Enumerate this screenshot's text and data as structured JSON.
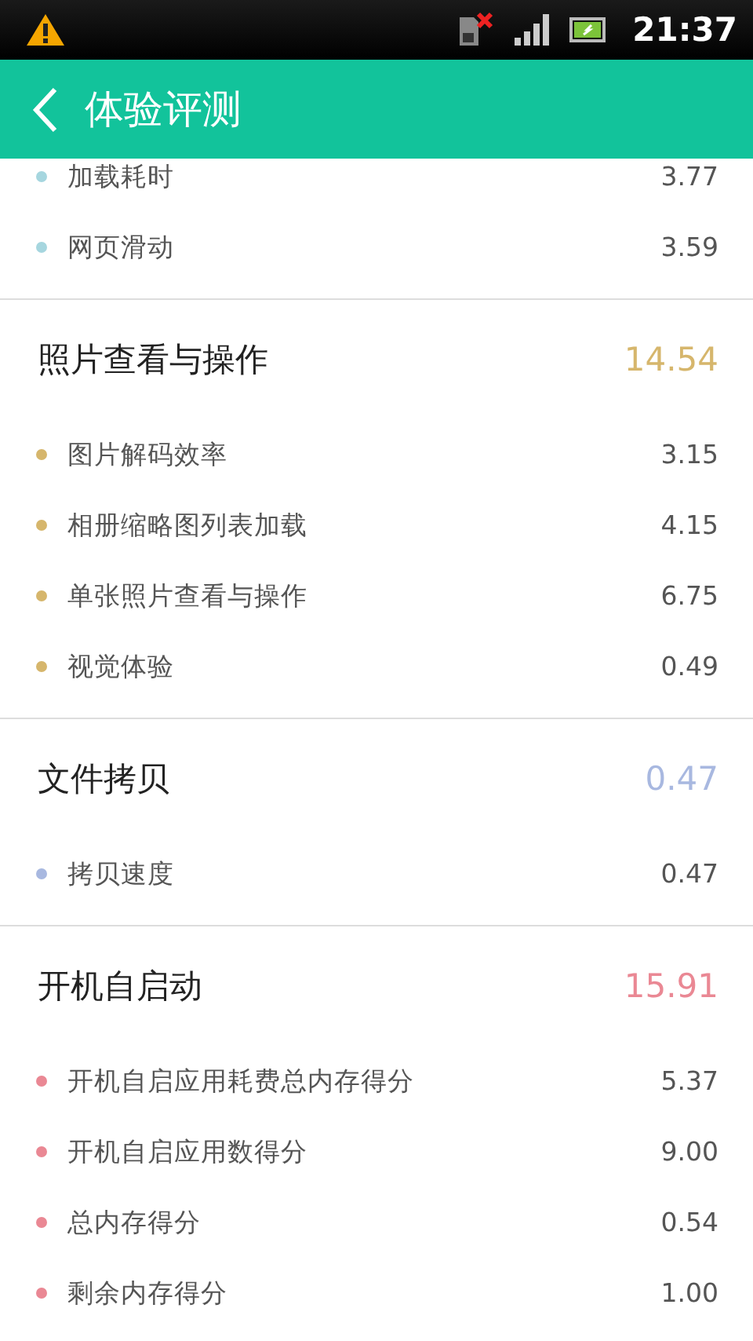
{
  "status_bar": {
    "time": "21:37"
  },
  "header": {
    "title": "体验评测"
  },
  "sections": [
    {
      "items": [
        {
          "label": "加载耗时",
          "value": "3.77"
        },
        {
          "label": "网页滑动",
          "value": "3.59"
        }
      ],
      "color": "#a6d6df"
    },
    {
      "title": "照片查看与操作",
      "score": "14.54",
      "color": "#d6b66c",
      "items": [
        {
          "label": "图片解码效率",
          "value": "3.15"
        },
        {
          "label": "相册缩略图列表加载",
          "value": "4.15"
        },
        {
          "label": "单张照片查看与操作",
          "value": "6.75"
        },
        {
          "label": "视觉体验",
          "value": "0.49"
        }
      ]
    },
    {
      "title": "文件拷贝",
      "score": "0.47",
      "color": "#a8b8e0",
      "items": [
        {
          "label": "拷贝速度",
          "value": "0.47"
        }
      ]
    },
    {
      "title": "开机自启动",
      "score": "15.91",
      "color": "#ea8894",
      "items": [
        {
          "label": "开机自启应用耗费总内存得分",
          "value": "5.37"
        },
        {
          "label": "开机自启应用数得分",
          "value": "9.00"
        },
        {
          "label": "总内存得分",
          "value": "0.54"
        },
        {
          "label": "剩余内存得分",
          "value": "1.00"
        }
      ]
    }
  ]
}
